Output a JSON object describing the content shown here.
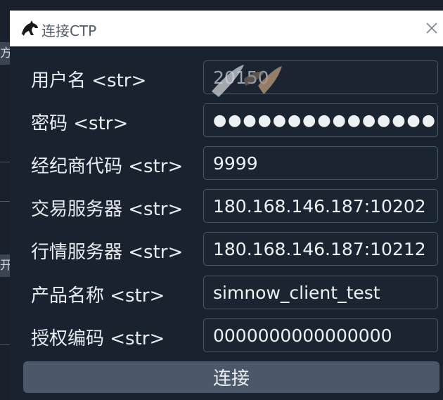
{
  "window": {
    "title": "连接CTP",
    "icon": "horse-logo-icon",
    "close_icon": "close-icon"
  },
  "background_fragments": [
    "方",
    "开"
  ],
  "form": {
    "rows": [
      {
        "label": "用户名 <str>",
        "value": "20150",
        "kind": "text"
      },
      {
        "label": "密码 <str>",
        "value": "●●●●●●●●●●●●●●●",
        "kind": "password"
      },
      {
        "label": "经纪商代码 <str>",
        "value": "9999",
        "kind": "text"
      },
      {
        "label": "交易服务器 <str>",
        "value": "180.168.146.187:10202",
        "kind": "text"
      },
      {
        "label": "行情服务器 <str>",
        "value": "180.168.146.187:10212",
        "kind": "text"
      },
      {
        "label": "产品名称 <str>",
        "value": "simnow_client_test",
        "kind": "text"
      },
      {
        "label": "授权编码 <str>",
        "value": "0000000000000000",
        "kind": "text"
      }
    ]
  },
  "actions": {
    "connect_label": "连接"
  },
  "colors": {
    "dialog_bg": "#19232f",
    "titlebar_bg": "#ffffff",
    "field_border": "#4a5668",
    "button_bg": "#4c5869",
    "text": "#e8ecf0"
  }
}
